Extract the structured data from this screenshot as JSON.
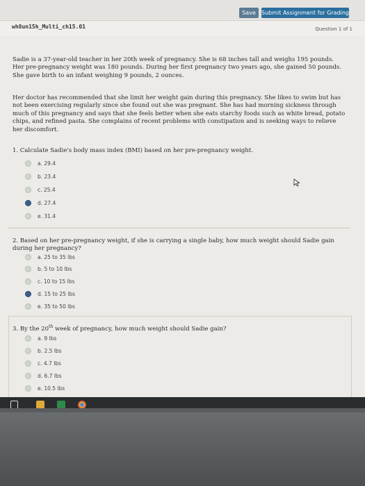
{
  "toolbar": {
    "save_label": "Save",
    "submit_label": "Submit Assignment for Grading"
  },
  "header": {
    "filename": "wh8un15h_Multi_ch15.01",
    "question_counter": "Question 1 of 1"
  },
  "case": {
    "paragraph1": "Sadie is a 37-year-old teacher in her 20th week of pregnancy. She is 68 inches tall and weighs 195 pounds. Her pre-pregnancy weight was 180 pounds. During her first pregnancy two years ago, she gained 50 pounds. She gave birth to an infant weighing 9 pounds, 2 ounces.",
    "paragraph2": "Her doctor has recommended that she limit her weight gain during this pregnancy. She likes to swim but has not been exercising regularly since she found out she was pregnant. She has had morning sickness through much of this pregnancy and says that she feels better when she eats starchy foods such as white bread, potato chips, and refined pasta. She complains of recent problems with constipation and is seeking ways to relieve her discomfort."
  },
  "questions": [
    {
      "text": "1. Calculate Sadie's body mass index (BMI) based on her pre-pregnancy weight.",
      "options": [
        "a. 29.4",
        "b. 23.4",
        "c. 25.4",
        "d. 27.4",
        "e. 31.4"
      ],
      "selected": 3
    },
    {
      "text": "2. Based on her pre-pregnancy weight, if she is carrying a single baby, how much weight should Sadie gain during her pregnancy?",
      "options": [
        "a. 25 to 35 lbs",
        "b. 5 to 10 lbs",
        "c. 10 to 15 lbs",
        "d. 15 to 25 lbs",
        "e. 35 to 50 lbs"
      ],
      "selected": 3
    },
    {
      "text_before": "3. By the 20",
      "text_sup": "th",
      "text_after": " week of pregnancy, how much weight should Sadie gain?",
      "options": [
        "a. 9 lbs",
        "b. 2.5 lbs",
        "c. 4.7 lbs",
        "d. 6.7 lbs",
        "e. 10.5 lbs"
      ],
      "selected": -1
    }
  ],
  "colors": {
    "submit": "#2b6f9e",
    "save": "#5d7b94",
    "radio_selected": "#3a5f8a"
  }
}
